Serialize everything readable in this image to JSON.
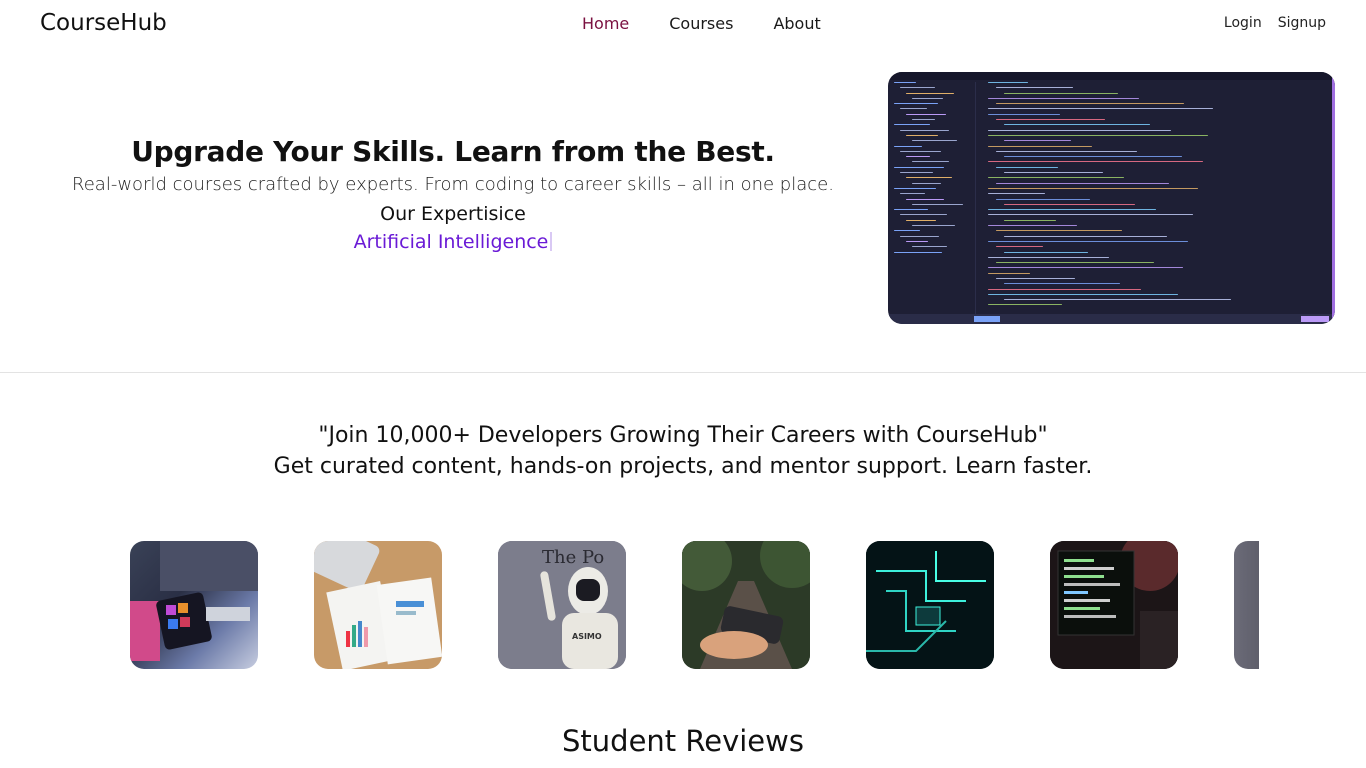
{
  "nav": {
    "brand": "CourseHub",
    "links": [
      {
        "label": "Home",
        "active": true
      },
      {
        "label": "Courses",
        "active": false
      },
      {
        "label": "About",
        "active": false
      }
    ],
    "login": "Login",
    "signup": "Signup"
  },
  "hero": {
    "title": "Upgrade Your Skills. Learn from the Best.",
    "subtitle": "Real-world courses crafted by experts. From coding to career skills – all in one place.",
    "expertise_label": "Our Expertisice",
    "expertise_value": "Artificial Intelligence",
    "image": "code-editor-screenshot"
  },
  "quote": {
    "line1": "\"Join 10,000+ Developers Growing Their Careers with CourseHub\"",
    "line2": "Get curated content, hands-on projects, and mentor support. Learn faster."
  },
  "gallery": {
    "images": [
      "desktop-with-adobe-apps-phone",
      "laptop-with-charts-papers",
      "humanoid-robot-asimo",
      "phone-in-hand-forest-road",
      "glowing-circuit-board",
      "monitor-with-terminal-code",
      "partial-dark-image"
    ]
  },
  "reviews": {
    "title": "Student Reviews"
  },
  "colors": {
    "active_link": "#7a1040",
    "expertise_accent": "#6a1ad6",
    "editor_bg": "#1e1f35"
  }
}
